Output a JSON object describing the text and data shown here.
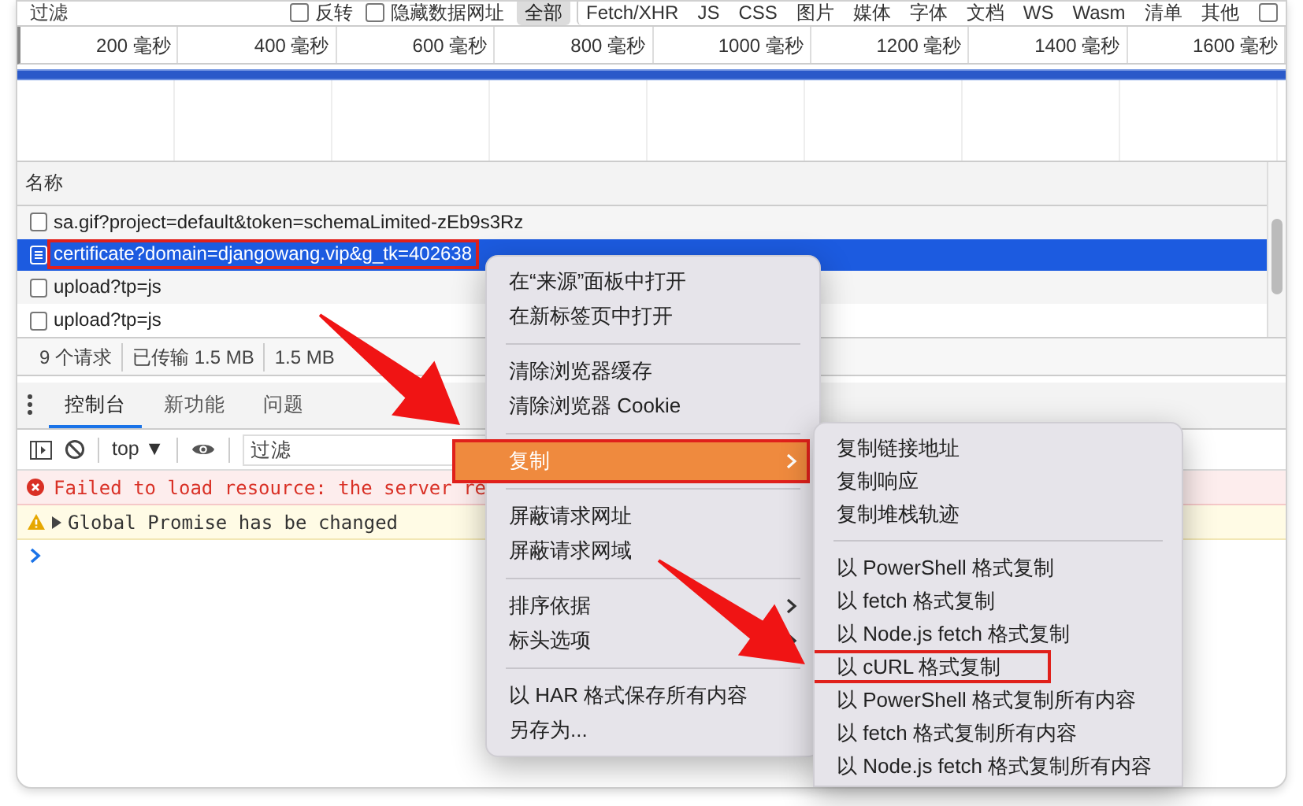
{
  "filter_bar": {
    "placeholder": "过滤",
    "options": [
      {
        "label": "反转",
        "checked": false
      },
      {
        "label": "隐藏数据网址",
        "checked": false
      }
    ],
    "types": [
      {
        "label": "全部",
        "selected": true
      },
      {
        "label": "Fetch/XHR",
        "selected": false
      },
      {
        "label": "JS",
        "selected": false
      },
      {
        "label": "CSS",
        "selected": false
      },
      {
        "label": "图片",
        "selected": false
      },
      {
        "label": "媒体",
        "selected": false
      },
      {
        "label": "字体",
        "selected": false
      },
      {
        "label": "文档",
        "selected": false
      },
      {
        "label": "WS",
        "selected": false
      },
      {
        "label": "Wasm",
        "selected": false
      },
      {
        "label": "清单",
        "selected": false
      },
      {
        "label": "其他",
        "selected": false
      }
    ],
    "trailing_checkbox": {
      "checked": false
    }
  },
  "timeline": {
    "ticks": [
      "200 毫秒",
      "400 毫秒",
      "600 毫秒",
      "800 毫秒",
      "1000 毫秒",
      "1200 毫秒",
      "1400 毫秒",
      "1600 毫秒"
    ]
  },
  "requests": {
    "column": "名称",
    "rows": [
      {
        "name": "sa.gif?project=default&token=schemaLimited-zEb9s3Rz",
        "selected": false,
        "annotated": false
      },
      {
        "name": "certificate?domain=djangowang.vip&g_tk=402638",
        "selected": true,
        "annotated": true
      },
      {
        "name": "upload?tp=js",
        "selected": false,
        "annotated": false
      },
      {
        "name": "upload?tp=js",
        "selected": false,
        "annotated": false
      }
    ]
  },
  "status_bar": [
    "9 个请求",
    "已传输 1.5 MB",
    "1.5 MB"
  ],
  "drawer_tabs": [
    {
      "label": "控制台",
      "selected": true
    },
    {
      "label": "新功能",
      "selected": false
    },
    {
      "label": "问题",
      "selected": false
    }
  ],
  "console": {
    "context": "top ▼",
    "filter_placeholder": "过滤",
    "messages": [
      {
        "kind": "error",
        "text": "Failed to load resource: the server re"
      },
      {
        "kind": "warning",
        "text": "Global Promise has be changed"
      }
    ]
  },
  "context_menu": {
    "items": [
      {
        "kind": "item",
        "label": "在“来源”面板中打开",
        "selected": false,
        "has_submenu": false,
        "annotated": false
      },
      {
        "kind": "item",
        "label": "在新标签页中打开",
        "selected": false,
        "has_submenu": false,
        "annotated": false
      },
      {
        "kind": "separator"
      },
      {
        "kind": "item",
        "label": "清除浏览器缓存",
        "selected": false,
        "has_submenu": false,
        "annotated": false
      },
      {
        "kind": "item",
        "label": "清除浏览器 Cookie",
        "selected": false,
        "has_submenu": false,
        "annotated": false
      },
      {
        "kind": "separator"
      },
      {
        "kind": "item",
        "label": "复制",
        "selected": true,
        "has_submenu": true,
        "annotated": true
      },
      {
        "kind": "separator"
      },
      {
        "kind": "item",
        "label": "屏蔽请求网址",
        "selected": false,
        "has_submenu": false,
        "annotated": false
      },
      {
        "kind": "item",
        "label": "屏蔽请求网域",
        "selected": false,
        "has_submenu": false,
        "annotated": false
      },
      {
        "kind": "separator"
      },
      {
        "kind": "item",
        "label": "排序依据",
        "selected": false,
        "has_submenu": true,
        "annotated": false
      },
      {
        "kind": "item",
        "label": "标头选项",
        "selected": false,
        "has_submenu": true,
        "annotated": false
      },
      {
        "kind": "separator"
      },
      {
        "kind": "item",
        "label": "以 HAR 格式保存所有内容",
        "selected": false,
        "has_submenu": false,
        "annotated": false
      },
      {
        "kind": "item",
        "label": "另存为...",
        "selected": false,
        "has_submenu": false,
        "annotated": false
      }
    ]
  },
  "copy_submenu": {
    "items": [
      {
        "kind": "item",
        "label": "复制链接地址",
        "annotated": false
      },
      {
        "kind": "item",
        "label": "复制响应",
        "annotated": false
      },
      {
        "kind": "item",
        "label": "复制堆栈轨迹",
        "annotated": false
      },
      {
        "kind": "separator"
      },
      {
        "kind": "item",
        "label": "以 PowerShell 格式复制",
        "annotated": false
      },
      {
        "kind": "item",
        "label": "以 fetch 格式复制",
        "annotated": false
      },
      {
        "kind": "item",
        "label": "以 Node.js fetch 格式复制",
        "annotated": false
      },
      {
        "kind": "item",
        "label": "以 cURL 格式复制",
        "annotated": true
      },
      {
        "kind": "item",
        "label": "以 PowerShell 格式复制所有内容",
        "annotated": false
      },
      {
        "kind": "item",
        "label": "以 fetch 格式复制所有内容",
        "annotated": false
      },
      {
        "kind": "item",
        "label": "以 Node.js fetch 格式复制所有内容",
        "annotated": false
      }
    ]
  }
}
